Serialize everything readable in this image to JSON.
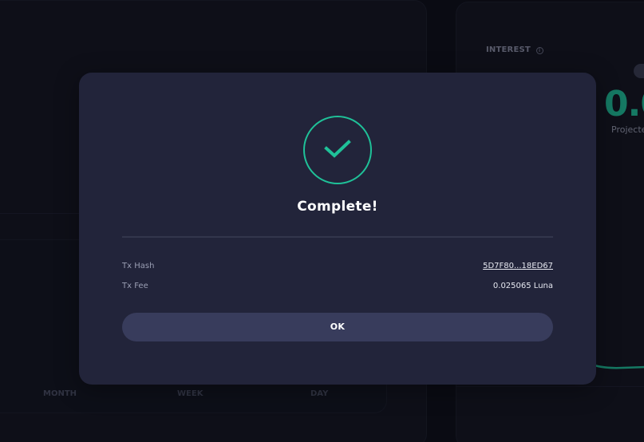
{
  "background": {
    "interest_label": "INTEREST",
    "info_icon_glyph": "i",
    "interest_value": "0.0",
    "projected_label": "Projecte",
    "periods": [
      "MONTH",
      "WEEK",
      "DAY"
    ]
  },
  "modal": {
    "title": "Complete!",
    "tx_hash_label": "Tx Hash",
    "tx_hash_value": "5D7F80...18ED67",
    "tx_fee_label": "Tx Fee",
    "tx_fee_value": "0.025065 Luna",
    "ok_label": "OK",
    "status_icon": "checkmark-icon"
  },
  "colors": {
    "accent": "#1fc198",
    "modal_bg": "#22243a",
    "button_bg": "#383c5c",
    "page_bg": "#0d0f18"
  }
}
